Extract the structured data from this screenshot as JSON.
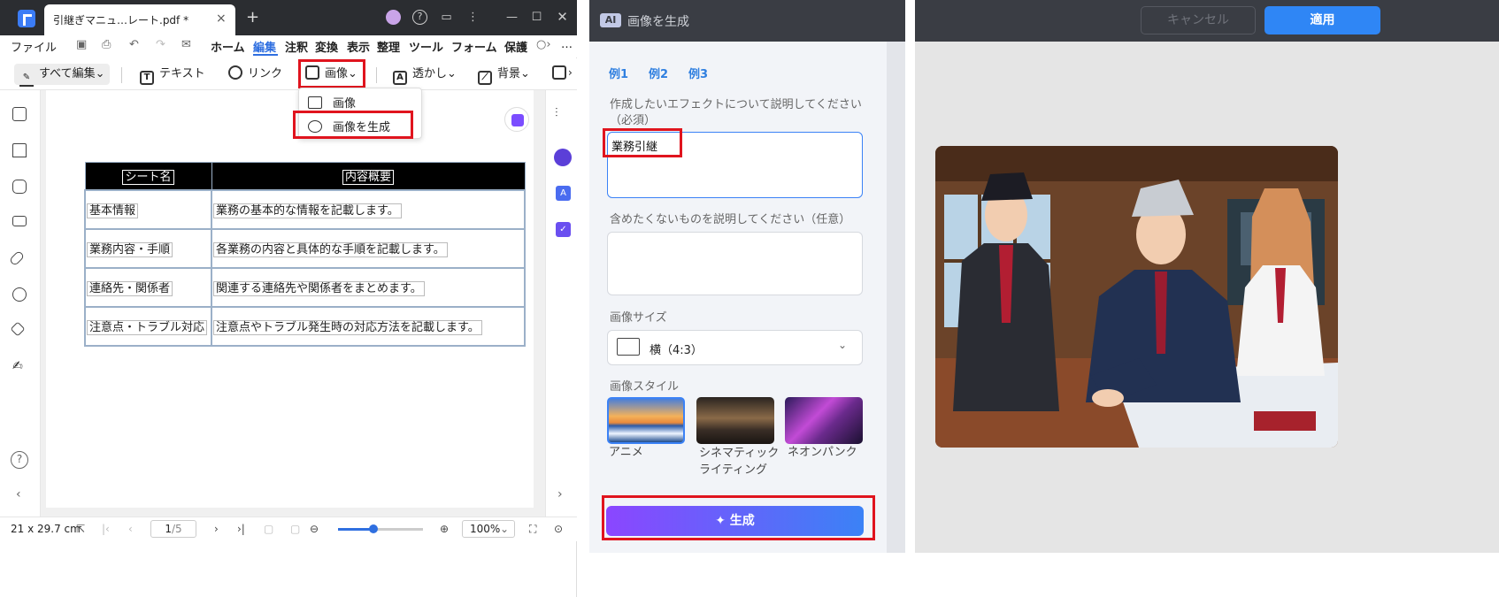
{
  "editor": {
    "tab_title": "引継ぎマニュ…レート.pdf *",
    "tab_close": "×",
    "new_tab": "+",
    "menu": [
      "ファイル",
      "ホーム",
      "編集",
      "注釈",
      "変換",
      "表示",
      "整理",
      "ツール",
      "フォーム",
      "保護"
    ],
    "toolbar": {
      "all_edit": "すべて編集",
      "text": "テキスト",
      "link": "リンク",
      "image": "画像",
      "watermark": "透かし",
      "background": "背景"
    },
    "image_menu": {
      "image": "画像",
      "generate": "画像を生成"
    },
    "table": {
      "headers": [
        "シート名",
        "内容概要"
      ],
      "rows": [
        [
          "基本情報",
          "業務の基本的な情報を記載します。"
        ],
        [
          "業務内容・手順",
          "各業務の内容と具体的な手順を記載します。"
        ],
        [
          "連絡先・関係者",
          "関連する連絡先や関係者をまとめます。"
        ],
        [
          "注意点・トラブル対応",
          "注意点やトラブル発生時の対応方法を記載します。"
        ]
      ]
    },
    "status": {
      "page_size": "21 x 29.7 cm",
      "page_current": "1",
      "page_total": "/5",
      "zoom": "100%",
      "zoom_fraction": 0.4
    }
  },
  "generator": {
    "badge": "AI",
    "title": "画像を生成",
    "examples": [
      "例1",
      "例2",
      "例3"
    ],
    "prompt_label": "作成したいエフェクトについて説明してください",
    "prompt_required": "（必須）",
    "prompt_value": "業務引継",
    "negative_label": "含めたくないものを説明してください（任意）",
    "size_label": "画像サイズ",
    "size_value": "横（4:3）",
    "style_label": "画像スタイル",
    "styles": [
      {
        "name": "アニメ",
        "selected": true
      },
      {
        "name": "シネマティック\nライティング",
        "selected": false
      },
      {
        "name": "ネオンパンク",
        "selected": false
      }
    ],
    "generate_label": "生成"
  },
  "result_panel": {
    "cancel": "キャンセル",
    "apply": "適用"
  },
  "colors": {
    "accent": "#2f6fe0",
    "highlight": "#e0141e",
    "generate_gradient_start": "#8b46ff",
    "generate_gradient_end": "#3b82f6"
  }
}
